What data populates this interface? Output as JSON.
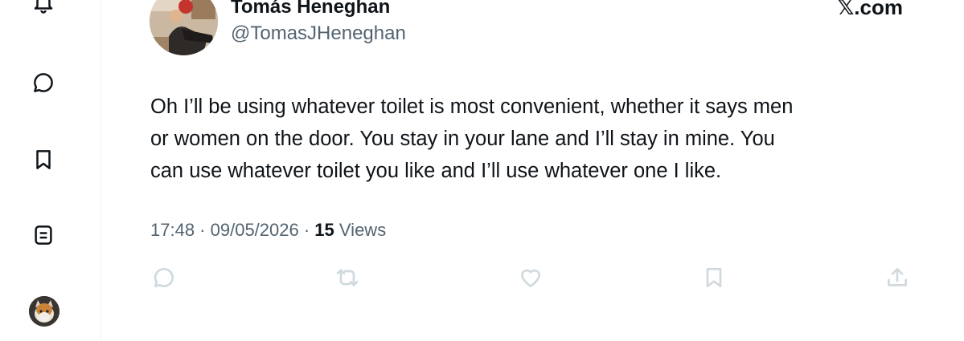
{
  "sidebar": {
    "items": [
      {
        "icon": "bell-icon"
      },
      {
        "icon": "message-bubble-icon"
      },
      {
        "icon": "bookmark-icon"
      },
      {
        "icon": "list-icon"
      },
      {
        "icon": "profile-avatar"
      }
    ]
  },
  "tweet": {
    "author": {
      "name": "Tomás Heneghan",
      "handle": "@TomasJHeneghan"
    },
    "brand": "𝕏.com",
    "text_lines": [
      "Oh I’ll be using whatever toilet is most convenient, whether it says men",
      "or women on the door. You stay in your lane and I’ll stay in mine. You",
      "can use whatever toilet you like and I’ll use whatever one I like."
    ],
    "time": "17:48",
    "date": "09/05/2026",
    "separator": " · ",
    "views_count": "15",
    "views_label": "Views"
  },
  "actions": [
    {
      "icon": "reply-icon"
    },
    {
      "icon": "retweet-icon"
    },
    {
      "icon": "like-icon"
    },
    {
      "icon": "bookmark-icon"
    },
    {
      "icon": "share-icon"
    }
  ],
  "colors": {
    "text_primary": "#0f1419",
    "text_secondary": "#536471",
    "action_icon": "#cfd9de",
    "divider": "#eff3f4"
  }
}
